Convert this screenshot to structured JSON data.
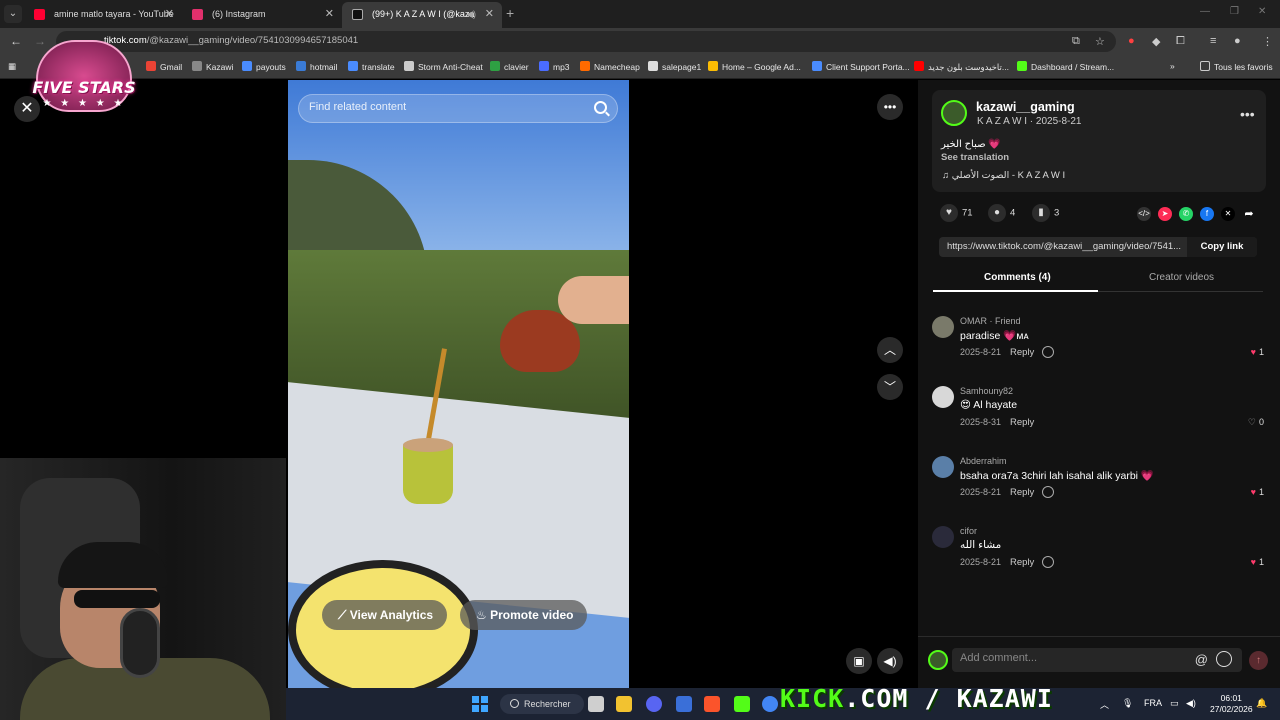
{
  "browser": {
    "tabs": [
      {
        "label": "amine matlo tayara - YouTube",
        "favicon_color": "#ff0033",
        "active": false
      },
      {
        "label": "(6) Instagram",
        "favicon_color": "#e1306c",
        "active": false
      },
      {
        "label": "(99+) K A Z A W I (@kaza",
        "favicon_color": "#111111",
        "active": true
      }
    ],
    "url_host": "tiktok.com",
    "url_path": "/@kazawi__gaming/video/7541030994657185041",
    "bookmarks": [
      {
        "label": "Gmail",
        "color": "#ea4335"
      },
      {
        "label": "Kazawi",
        "color": "#888888"
      },
      {
        "label": "payouts",
        "color": "#4a8cff"
      },
      {
        "label": "hotmail",
        "color": "#3a7bd5"
      },
      {
        "label": "translate",
        "color": "#4a8cff"
      },
      {
        "label": "Storm Anti-Cheat",
        "color": "#cccccc"
      },
      {
        "label": "clavier",
        "color": "#2ea043"
      },
      {
        "label": "mp3",
        "color": "#4a6cff"
      },
      {
        "label": "Namecheap",
        "color": "#ff6a00"
      },
      {
        "label": "salepage1",
        "color": "#dddddd"
      },
      {
        "label": "Home – Google Ad...",
        "color": "#fbbc04"
      },
      {
        "label": "Client Support Porta...",
        "color": "#4a8cff"
      },
      {
        "label": "تاخيدوست بلون جديد...",
        "color": "#ff0000"
      },
      {
        "label": "Dashboard / Stream...",
        "color": "#53fc18"
      }
    ],
    "all_bookmarks_label": "Tous les favoris"
  },
  "video": {
    "search_placeholder": "Find related content",
    "view_analytics_label": "View Analytics",
    "promote_label": "Promote video"
  },
  "author": {
    "username": "kazawi__gaming",
    "display_date": "K A Z A W I · 2025-8-21",
    "caption": "صباح الخير 💗",
    "see_translation": "See translation",
    "music": "الصوت الأصلي - K A Z A W I"
  },
  "stats": {
    "likes": "71",
    "comments": "4",
    "saves": "3"
  },
  "share": {
    "link": "https://www.tiktok.com/@kazawi__gaming/video/7541...",
    "copy_label": "Copy link"
  },
  "panel_tabs": {
    "comments": "Comments (4)",
    "creator_videos": "Creator videos"
  },
  "comments": [
    {
      "name": "OMAR · Friend",
      "text": "paradise 💗ᴍᴀ",
      "date": "2025-8-21",
      "reply": "Reply",
      "likes": "1",
      "liked": true,
      "avatar_color": "#7a7a6a"
    },
    {
      "name": "Samhouny82",
      "text": "😍 Al hayate",
      "date": "2025-8-31",
      "reply": "Reply",
      "likes": "0",
      "liked": false,
      "avatar_color": "#d8d8d8"
    },
    {
      "name": "Abderrahim",
      "text": "bsaha ora7a 3chiri lah isahal alik yarbi 💗",
      "date": "2025-8-21",
      "reply": "Reply",
      "likes": "1",
      "liked": true,
      "avatar_color": "#5a7fa8"
    },
    {
      "name": "cifor",
      "text": "مشاء الله",
      "date": "2025-8-21",
      "reply": "Reply",
      "likes": "1",
      "liked": true,
      "avatar_color": "#2a2a3a"
    }
  ],
  "comment_box": {
    "placeholder": "Add comment..."
  },
  "taskbar": {
    "search_label": "Rechercher",
    "lang": "FRA",
    "time": "06:01",
    "date": "27/02/2026"
  },
  "overlay": {
    "kick_green": "KICK",
    "kick_rest": ".COM / KAZAWI",
    "logo_text": "FIVE STARS",
    "logo_stars": "★ ★ ★ ★ ★"
  }
}
